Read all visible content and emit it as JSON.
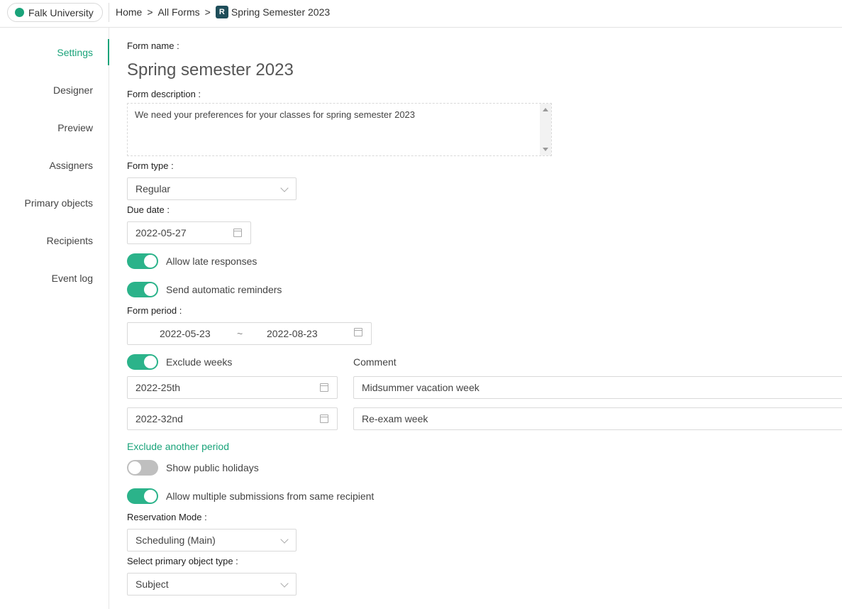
{
  "header": {
    "org": "Falk University",
    "breadcrumb": {
      "home": "Home",
      "sep1": ">",
      "all_forms": "All Forms",
      "sep2": ">",
      "badge": "R",
      "current": "Spring Semester 2023"
    }
  },
  "sidebar": {
    "items": [
      {
        "label": "Settings",
        "active": true
      },
      {
        "label": "Designer"
      },
      {
        "label": "Preview"
      },
      {
        "label": "Assigners"
      },
      {
        "label": "Primary objects"
      },
      {
        "label": "Recipients"
      },
      {
        "label": "Event log"
      }
    ]
  },
  "form": {
    "name_label": "Form name :",
    "name_value": "Spring semester 2023",
    "desc_label": "Form description :",
    "desc_value": "We need your preferences for your classes for spring semester 2023",
    "type_label": "Form type :",
    "type_value": "Regular",
    "due_label": "Due date :",
    "due_value": "2022-05-27",
    "allow_late": {
      "label": "Allow late responses",
      "on": true
    },
    "send_reminders": {
      "label": "Send automatic reminders",
      "on": true
    },
    "period_label": "Form period :",
    "period_start": "2022-05-23",
    "period_sep": "~",
    "period_end": "2022-08-23",
    "exclude_weeks": {
      "label": "Exclude weeks",
      "on": true
    },
    "comment_label": "Comment",
    "excluded": [
      {
        "week": "2022-25th",
        "comment": "Midsummer vacation week"
      },
      {
        "week": "2022-32nd",
        "comment": "Re-exam week"
      }
    ],
    "exclude_another": "Exclude another period",
    "public_holidays": {
      "label": "Show public holidays",
      "on": false
    },
    "multiple_submissions": {
      "label": "Allow multiple submissions from same recipient",
      "on": true
    },
    "reservation_label": "Reservation Mode :",
    "reservation_value": "Scheduling (Main)",
    "primary_type_label": "Select primary object type :",
    "primary_type_value": "Subject"
  },
  "colors": {
    "accent": "#1aa37a",
    "toggle_on": "#2bb38a",
    "toggle_off": "#bfbfbf",
    "badge": "#1f4e5a"
  }
}
